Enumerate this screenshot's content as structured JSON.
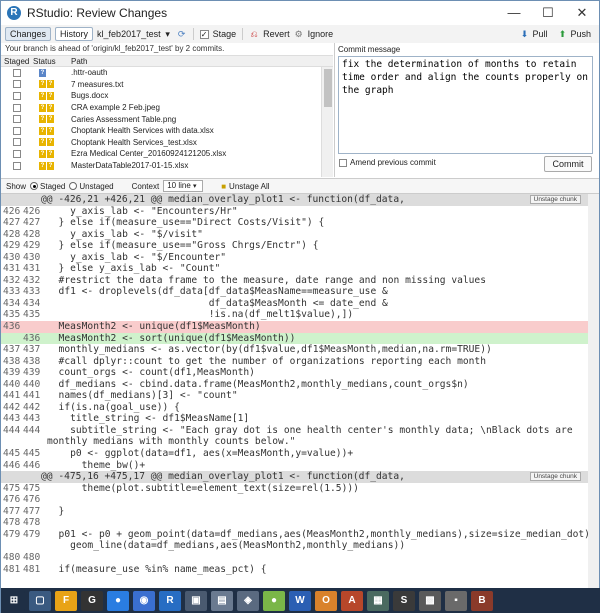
{
  "window": {
    "title": "RStudio: Review Changes",
    "minimize": "—",
    "maximize": "☐",
    "close": "✕"
  },
  "toolbar": {
    "changes_label": "Changes",
    "history_label": "History",
    "branch_label": "kl_feb2017_test",
    "stage_label": "Stage",
    "revert_label": "Revert",
    "ignore_label": "Ignore",
    "pull_label": "Pull",
    "push_label": "Push"
  },
  "branch_info": "Your branch is ahead of 'origin/kl_feb2017_test' by 2 commits.",
  "file_headers": {
    "staged": "Staged",
    "status": "Status",
    "path": "Path"
  },
  "files": [
    {
      "path": ".httr-oauth",
      "status": "blue",
      "glyph1": "?",
      "glyph2": ""
    },
    {
      "path": "7 measures.txt",
      "status": "yellow",
      "glyph1": "?",
      "glyph2": "?"
    },
    {
      "path": "Bugs.docx",
      "status": "yellow",
      "glyph1": "?",
      "glyph2": "?"
    },
    {
      "path": "CRA example 2 Feb.jpeg",
      "status": "yellow",
      "glyph1": "?",
      "glyph2": "?"
    },
    {
      "path": "Caries Assessment Table.png",
      "status": "yellow",
      "glyph1": "?",
      "glyph2": "?"
    },
    {
      "path": "Choptank Health Services with data.xlsx",
      "status": "yellow",
      "glyph1": "?",
      "glyph2": "?"
    },
    {
      "path": "Choptank Health Services_test.xlsx",
      "status": "yellow",
      "glyph1": "?",
      "glyph2": "?"
    },
    {
      "path": "Ezra Medical Center_20160924121205.xlsx",
      "status": "yellow",
      "glyph1": "?",
      "glyph2": "?"
    },
    {
      "path": "MasterDataTable2017-01-15.xlsx",
      "status": "yellow",
      "glyph1": "?",
      "glyph2": "?"
    }
  ],
  "commit": {
    "label": "Commit message",
    "message": "fix the determination of months to retain time order and align the counts properly on the graph",
    "amend_label": "Amend previous commit",
    "commit_button": "Commit"
  },
  "showbar": {
    "show_label": "Show",
    "staged_label": "Staged",
    "unstaged_label": "Unstaged",
    "context_label": "Context",
    "context_value": "10 line",
    "unstage_all_label": "Unstage All"
  },
  "unstage_chunk_label": "Unstage chunk",
  "diff_lines": [
    {
      "type": "hunk",
      "n1": "",
      "n2": "",
      "code": "@@ -426,21 +426,21 @@ median_overlay_plot1 <- function(df_data,"
    },
    {
      "type": "ctx",
      "n1": "426",
      "n2": "426",
      "code": "    y_axis_lab <- \"Encounters/Hr\""
    },
    {
      "type": "ctx",
      "n1": "427",
      "n2": "427",
      "code": "  } else if(measure_use==\"Direct Costs/Visit\") {"
    },
    {
      "type": "ctx",
      "n1": "428",
      "n2": "428",
      "code": "    y_axis_lab <- \"$/visit\""
    },
    {
      "type": "ctx",
      "n1": "429",
      "n2": "429",
      "code": "  } else if(measure_use==\"Gross Chrgs/Enctr\") {"
    },
    {
      "type": "ctx",
      "n1": "430",
      "n2": "430",
      "code": "    y_axis_lab <- \"$/Encounter\""
    },
    {
      "type": "ctx",
      "n1": "431",
      "n2": "431",
      "code": "  } else y_axis_lab <- \"Count\""
    },
    {
      "type": "ctx",
      "n1": "432",
      "n2": "432",
      "code": "  #restrict the data frame to the measure, date range and non missing values"
    },
    {
      "type": "ctx",
      "n1": "433",
      "n2": "433",
      "code": "  df1 <- droplevels(df_data[df_data$MeasName==measure_use &"
    },
    {
      "type": "ctx",
      "n1": "434",
      "n2": "434",
      "code": "                            df_data$MeasMonth <= date_end &"
    },
    {
      "type": "ctx",
      "n1": "435",
      "n2": "435",
      "code": "                            !is.na(df_melt1$value),])"
    },
    {
      "type": "del",
      "n1": "436",
      "n2": "",
      "code": "  MeasMonth2 <- unique(df1$MeasMonth)"
    },
    {
      "type": "add",
      "n1": "",
      "n2": "436",
      "code": "  MeasMonth2 <- sort(unique(df1$MeasMonth))"
    },
    {
      "type": "ctx",
      "n1": "437",
      "n2": "437",
      "code": "  monthly_medians <- as.vector(by(df1$value,df1$MeasMonth,median,na.rm=TRUE))"
    },
    {
      "type": "ctx",
      "n1": "438",
      "n2": "438",
      "code": "  #call dplyr::count to get the number of organizations reporting each month"
    },
    {
      "type": "ctx",
      "n1": "439",
      "n2": "439",
      "code": "  count_orgs <- count(df1,MeasMonth)"
    },
    {
      "type": "ctx",
      "n1": "440",
      "n2": "440",
      "code": "  df_medians <- cbind.data.frame(MeasMonth2,monthly_medians,count_orgs$n)"
    },
    {
      "type": "ctx",
      "n1": "441",
      "n2": "441",
      "code": "  names(df_medians)[3] <- \"count\""
    },
    {
      "type": "ctx",
      "n1": "442",
      "n2": "442",
      "code": "  if(is.na(goal_use)) {"
    },
    {
      "type": "ctx",
      "n1": "443",
      "n2": "443",
      "code": "    title_string <- df1$MeasName[1]"
    },
    {
      "type": "ctx",
      "n1": "444",
      "n2": "444",
      "code": "    subtitle_string <- \"Each gray dot is one health center's monthly data; \\nBlack dots are"
    },
    {
      "type": "ctx",
      "n1": "",
      "n2": "",
      "code": "monthly medians with monthly counts below.\""
    },
    {
      "type": "ctx",
      "n1": "445",
      "n2": "445",
      "code": "    p0 <- ggplot(data=df1, aes(x=MeasMonth,y=value))+"
    },
    {
      "type": "ctx",
      "n1": "446",
      "n2": "446",
      "code": "      theme_bw()+"
    },
    {
      "type": "hunk",
      "n1": "",
      "n2": "",
      "code": "@@ -475,16 +475,17 @@ median_overlay_plot1 <- function(df_data,"
    },
    {
      "type": "ctx",
      "n1": "475",
      "n2": "475",
      "code": "      theme(plot.subtitle=element_text(size=rel(1.5)))"
    },
    {
      "type": "ctx",
      "n1": "476",
      "n2": "476",
      "code": ""
    },
    {
      "type": "ctx",
      "n1": "477",
      "n2": "477",
      "code": "  }"
    },
    {
      "type": "ctx",
      "n1": "478",
      "n2": "478",
      "code": ""
    },
    {
      "type": "ctx",
      "n1": "479",
      "n2": "479",
      "code": "  p01 <- p0 + geom_point(data=df_medians,aes(MeasMonth2,monthly_medians),size=size_median_dot)+"
    },
    {
      "type": "ctx",
      "n1": "",
      "n2": "",
      "code": "    geom_line(data=df_medians,aes(MeasMonth2,monthly_medians))"
    },
    {
      "type": "ctx",
      "n1": "480",
      "n2": "480",
      "code": ""
    },
    {
      "type": "ctx",
      "n1": "481",
      "n2": "481",
      "code": "  if(measure_use %in% name_meas_pct) {"
    }
  ],
  "taskbar": [
    "⊞",
    "▢",
    "F",
    "G",
    "●",
    "◉",
    "R",
    "▣",
    "▤",
    "◈",
    "●",
    "W",
    "O",
    "A",
    "▦",
    "S",
    "▩",
    "▪",
    "B"
  ]
}
